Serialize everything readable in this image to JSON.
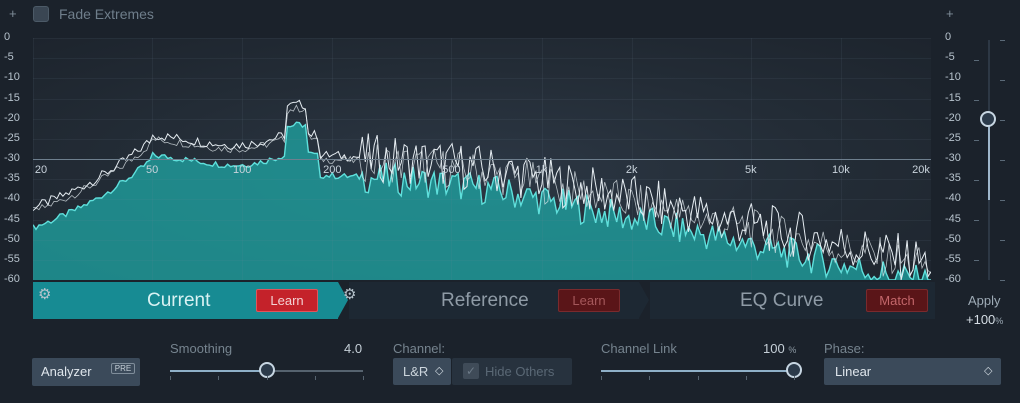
{
  "top": {
    "plus_left": "+",
    "plus_right": "+",
    "fade_extremes_label": "Fade Extremes",
    "fade_extremes_checked": false
  },
  "plot": {
    "frequency_labels": [
      "20",
      "50",
      "100",
      "200",
      "500",
      "1k",
      "2k",
      "5k",
      "10k",
      "20k"
    ],
    "db_labels_left": [
      "0",
      "-5",
      "-10",
      "-15",
      "-20",
      "-25",
      "-30",
      "-35",
      "-40",
      "-45",
      "-50",
      "-55",
      "-60"
    ],
    "db_labels_right": [
      "0",
      "-5",
      "-10",
      "-15",
      "-20",
      "-25",
      "-30",
      "-35",
      "-40",
      "-45",
      "-50",
      "-55",
      "-60"
    ],
    "colors": {
      "current_fill": "#1fa7a6",
      "current_line": "#5fe0dc",
      "reference_line": "#e6edf2"
    }
  },
  "apply": {
    "label": "Apply",
    "value": "+100",
    "unit": "%",
    "level_db": -20
  },
  "tabs": {
    "current": {
      "label": "Current",
      "learn_label": "Learn"
    },
    "reference": {
      "label": "Reference",
      "learn_label": "Learn"
    },
    "eq_curve": {
      "label": "EQ Curve",
      "match_label": "Match"
    }
  },
  "controls": {
    "analyzer": {
      "label": "Analyzer",
      "badge": "PRE"
    },
    "smoothing": {
      "label": "Smoothing",
      "value": "4.0",
      "fraction": 0.5
    },
    "channel": {
      "label": "Channel:",
      "value": "L&R",
      "hide_others_label": "Hide Others",
      "hide_others_checked": true
    },
    "channel_link": {
      "label": "Channel Link",
      "value": "100",
      "unit": "%",
      "fraction": 1.0
    },
    "phase": {
      "label": "Phase:",
      "value": "Linear"
    }
  }
}
